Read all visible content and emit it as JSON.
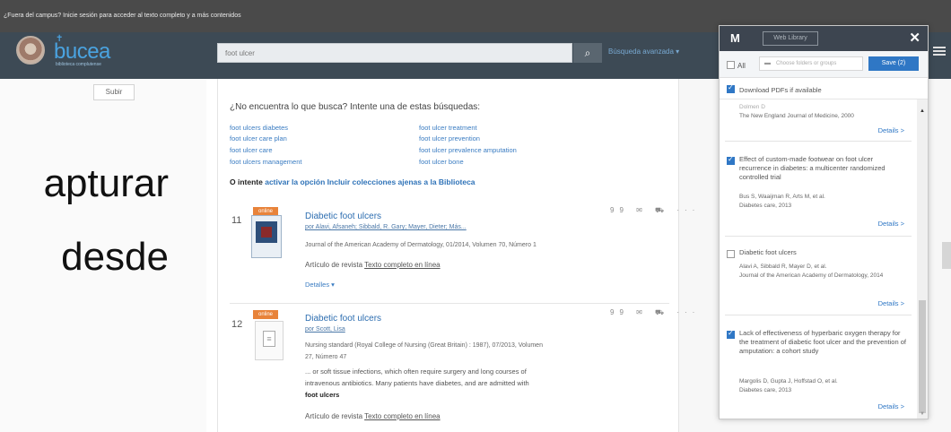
{
  "campus_bar": {
    "message": "¿Fuera del campus? Inicie sesión para acceder al texto completo y a más contenidos"
  },
  "header": {
    "logo_text": "bucea",
    "logo_sub": "biblioteca complutense",
    "search_value": "foot ulcer",
    "advanced_link": "Búsqueda avanzada ▾"
  },
  "left": {
    "subir_label": "Subir"
  },
  "overlay_text": {
    "line1": "apturar",
    "line2": "desde"
  },
  "suggestions": {
    "title": "¿No encuentra lo que busca? Intente una de estas búsquedas:",
    "col1": [
      "foot ulcers diabetes",
      "foot ulcer care plan",
      "foot ulcer care",
      "foot ulcers management"
    ],
    "col2": [
      "foot ulcer treatment",
      "foot ulcer prevention",
      "foot ulcer prevalence amputation",
      "foot ulcer bone"
    ],
    "also_prefix": "O intente",
    "also_link": "activar la opción Incluir colecciones ajenas a la Biblioteca"
  },
  "results": [
    {
      "num": "11",
      "badge": "online",
      "title": "Diabetic foot ulcers",
      "authors": "por Alavi, Afsaneh; Sibbald, R. Gary; Mayer, Dieter; Más...",
      "source": "Journal of the American Academy of Dermatology, 01/2014, Volumen 70, Número 1",
      "type_label": "Artículo de revista",
      "type_link": "Texto completo en línea",
      "details_label": "Detalles ▾"
    },
    {
      "num": "12",
      "badge": "online",
      "title": "Diabetic foot ulcers",
      "authors": "por Scott, Lisa",
      "source_line1": "Nursing standard (Royal College of Nursing (Great Britain) : 1987), 07/2013, Volumen",
      "source_line2": "27, Número 47",
      "snippet_line1": "... or soft tissue infections, which often require surgery and long courses of",
      "snippet_line2": "intravenous antibiotics. Many patients have diabetes, and are admitted with",
      "snippet_line3": "foot ulcers",
      "type_label": "Artículo de revista",
      "type_link": "Texto completo en línea"
    }
  ],
  "result_icons": "99 ✉ ⛟ ···",
  "panel": {
    "logo": "M",
    "web_library_label": "Web Library",
    "close_label": "✕",
    "all_label": "All",
    "folder_placeholder": "Choose folders or groups",
    "save_label": "Save (2)",
    "download_label": "Download PDFs if available",
    "items": [
      {
        "checked": false,
        "partial_top": "Dolmen D",
        "sub": "The New England Journal of Medicine, 2000",
        "details": "Details >"
      },
      {
        "checked": true,
        "title": "Effect of custom-made footwear on foot ulcer recurrence in diabetes: a multicenter randomized controlled trial",
        "authors": "Bus S, Waaijman R, Arts M, et al.",
        "journal": "Diabetes care, 2013",
        "details": "Details >"
      },
      {
        "checked": false,
        "title": "Diabetic foot ulcers",
        "authors": "Alavi A, Sibbald R, Mayer D, et al.",
        "journal": "Journal of the American Academy of Dermatology, 2014",
        "details": "Details >"
      },
      {
        "checked": true,
        "title": "Lack of effectiveness of hyperbaric oxygen therapy for the treatment of diabetic foot ulcer and the prevention of amputation: a cohort study",
        "authors": "Margolis D, Gupta J, Hoffstad O, et al.",
        "journal": "Diabetes care, 2013",
        "details": "Details >"
      }
    ]
  }
}
